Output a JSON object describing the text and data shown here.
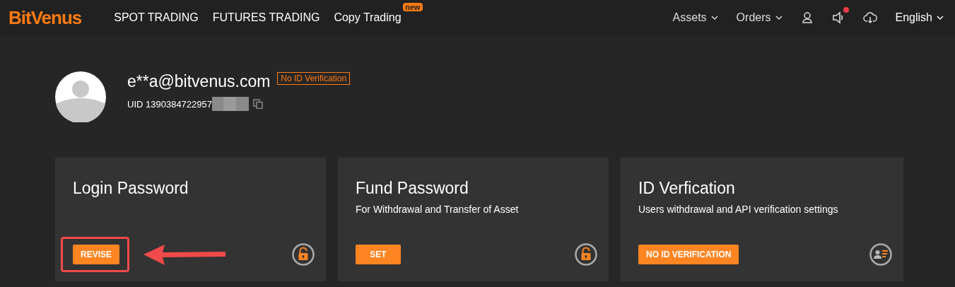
{
  "nav": {
    "logo": "BitVenus",
    "links": [
      {
        "label": "SPOT TRADING"
      },
      {
        "label": "FUTURES TRADING"
      },
      {
        "label": "Copy Trading",
        "badge": "new"
      }
    ],
    "menus": [
      {
        "label": "Assets"
      },
      {
        "label": "Orders"
      }
    ],
    "notification_dot": true,
    "language": "English"
  },
  "profile": {
    "email": "e**a@bitvenus.com",
    "verification_tag": "No ID Verification",
    "uid": "UID 1390384722957",
    "uid_masked": true
  },
  "cards": [
    {
      "title": "Login Password",
      "button": "REVISE",
      "kind": "lock",
      "highlighted": true
    },
    {
      "title": "Fund Password",
      "subtitle": "For Withdrawal and Transfer of Asset",
      "button": "SET",
      "kind": "lock",
      "highlighted": false
    },
    {
      "title": "ID Verfication",
      "subtitle": "Users withdrawal and API verification settings",
      "button": "NO ID VERIFICATION",
      "kind": "id",
      "highlighted": false
    }
  ]
}
